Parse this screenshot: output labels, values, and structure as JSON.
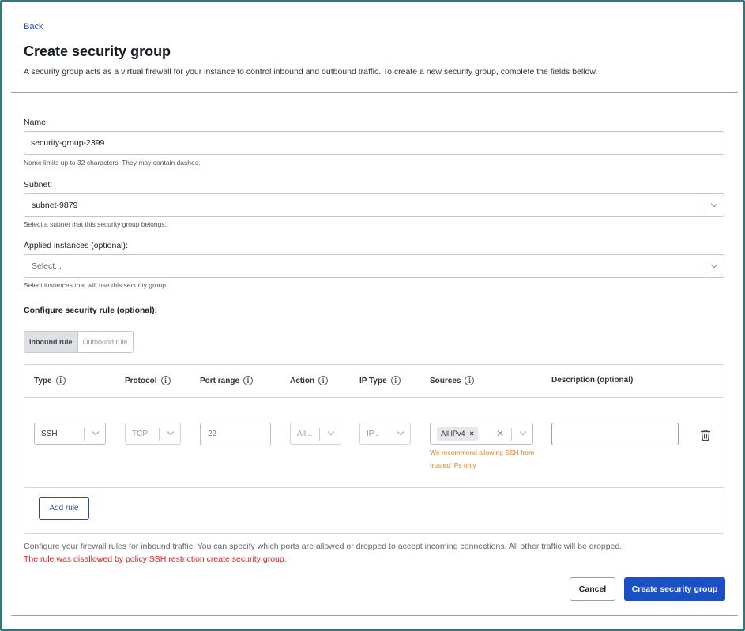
{
  "header": {
    "back_label": "Back",
    "title": "Create security group",
    "subtitle": "A security group acts as a virtual firewall for your instance to control inbound and outbound traffic. To create a new security group, complete the fields bellow."
  },
  "form": {
    "name": {
      "label": "Name:",
      "value": "security-group-2399",
      "hint": "Name limits up to 32 characters. They may contain dashes."
    },
    "subnet": {
      "label": "Subnet:",
      "value": "subnet-9879",
      "hint": "Select a subnet that this security group belongs."
    },
    "instances": {
      "label": "Applied instances (optional):",
      "placeholder": "Select...",
      "hint": "Select instances that will use this security group."
    }
  },
  "rules": {
    "section_label": "Configure security rule (optional):",
    "tabs": [
      {
        "label": "Inbound rule",
        "active": true
      },
      {
        "label": "Outbound rule",
        "active": false
      }
    ],
    "columns": [
      {
        "label": "Type",
        "info": true
      },
      {
        "label": "Protocol",
        "info": true
      },
      {
        "label": "Port range",
        "info": true
      },
      {
        "label": "Action",
        "info": true
      },
      {
        "label": "IP Type",
        "info": true
      },
      {
        "label": "Sources",
        "info": true
      },
      {
        "label": "Description (optional)",
        "info": false
      }
    ],
    "row": {
      "type": "SSH",
      "protocol": "TCP",
      "port_range": "22",
      "action": "All...",
      "ip_type": "IP...",
      "sources_tag": "All IPv4",
      "description": "",
      "warning": "We recommend allowing SSH from trusted IPs only"
    },
    "add_rule_label": "Add rule",
    "info_glyph": "i"
  },
  "footer": {
    "note": "Configure your firewall rules for inbound traffic. You can specify which ports are allowed or dropped to accept incoming connections. All other traffic will be dropped.",
    "error": "The rule was disallowed by policy SSH restriction create security group.",
    "cancel_label": "Cancel",
    "create_label": "Create security group"
  },
  "colors": {
    "accent": "#1a4fc6",
    "link": "#1d4fb8",
    "error": "#e02020",
    "warning": "#d9822b",
    "frame_border": "#2c7a7b"
  },
  "icons": [
    "info-icon",
    "chevron-down-icon",
    "close-icon",
    "trash-icon"
  ]
}
